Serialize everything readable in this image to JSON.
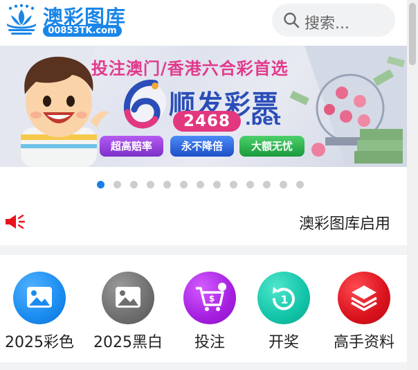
{
  "header": {
    "logo_cn": "澳彩图库",
    "logo_en": "00853TK.com",
    "search_placeholder": "搜索..."
  },
  "banner": {
    "headline": "投注澳门/香港六合彩首选",
    "brand_name": "顺发彩票",
    "brand_number": "2468",
    "brand_suffix": ".bet",
    "pills": [
      "超高赔率",
      "永不降倍",
      "大额无忧"
    ]
  },
  "carousel": {
    "total_dots": 13,
    "active_index": 0
  },
  "notice": {
    "text": "澳彩图库启用"
  },
  "menu": [
    {
      "label": "2025彩色",
      "icon": "image-icon",
      "color": "#1a8cf0"
    },
    {
      "label": "2025黑白",
      "icon": "image-icon",
      "color": "#6e6e6e"
    },
    {
      "label": "投注",
      "icon": "shopping-cart-icon",
      "color": "#a61fe0"
    },
    {
      "label": "开奖",
      "icon": "refresh-clock-icon",
      "color": "#12c4a8"
    },
    {
      "label": "高手资料",
      "icon": "layers-icon",
      "color": "#d9121c"
    }
  ],
  "colors": {
    "brand": "#1a86e8",
    "accent_red": "#e8131b",
    "background_gap": "#f2f3f5"
  }
}
